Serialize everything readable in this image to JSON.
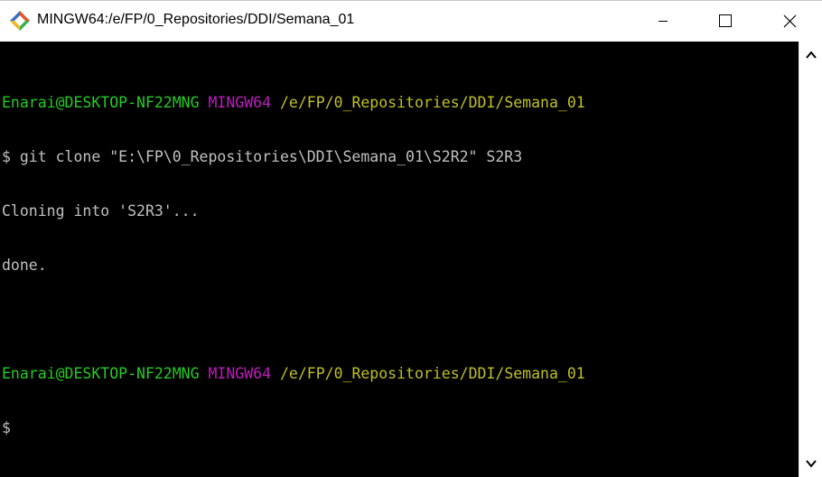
{
  "window": {
    "title": "MINGW64:/e/FP/0_Repositories/DDI/Semana_01",
    "icon": "git-bash-icon",
    "controls": [
      "minimize-icon",
      "maximize-icon",
      "close-icon"
    ]
  },
  "colors": {
    "user_host": "#23cc23",
    "system": "#c01bc0",
    "path": "#c0c025",
    "text": "#c0c0c0",
    "background": "#000000"
  },
  "terminal": {
    "prompt1": {
      "user_host": "Enarai@DESKTOP-NF22MNG",
      "system": "MINGW64",
      "path": "/e/FP/0_Repositories/DDI/Semana_01"
    },
    "command": "$ git clone \"E:\\FP\\0_Repositories\\DDI\\Semana_01\\S2R2\" S2R3",
    "output1": "Cloning into 'S2R3'...",
    "output2": "done.",
    "prompt2": {
      "user_host": "Enarai@DESKTOP-NF22MNG",
      "system": "MINGW64",
      "path": "/e/FP/0_Repositories/DDI/Semana_01"
    },
    "cursor_line": "$"
  }
}
